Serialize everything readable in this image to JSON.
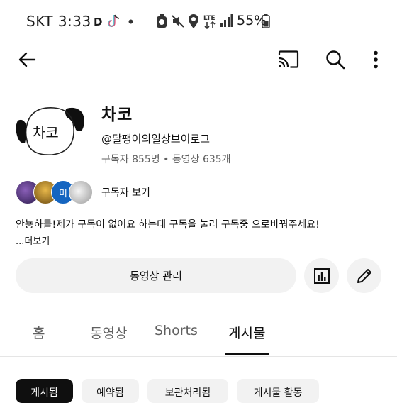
{
  "status_bar": {
    "carrier_time": "SKT 3:33",
    "d_label": "D",
    "battery_percent": "55%",
    "icons": [
      "tiktok-icon",
      "dot-icon",
      "alarm-icon",
      "mute-icon",
      "location-icon",
      "lte-icon",
      "signal-icon",
      "battery-icon"
    ]
  },
  "app_bar": {
    "icons": [
      "back-arrow-icon",
      "cast-icon",
      "search-icon",
      "more-vertical-icon"
    ]
  },
  "channel": {
    "avatar_text": "차코",
    "title": "차코",
    "handle": "@달팽이의일상브이로그",
    "stats": "구독자 855명 • 동영상 635개",
    "subscribers_link": "구독자 보기",
    "sub_avatar_label": "미",
    "description": "안뇽하들!제가 구독이 없어요 하는데 구독을 눌러 구독중 으로바꿔주세요!",
    "more_label": "...더보기"
  },
  "actions": {
    "manage_videos_label": "동영상 관리",
    "analytics_icon": "analytics-icon",
    "edit_icon": "edit-pencil-icon"
  },
  "tabs": [
    {
      "label": "홈",
      "active": false
    },
    {
      "label": "동영상",
      "active": false
    },
    {
      "label": "Shorts",
      "active": false
    },
    {
      "label": "게시물",
      "active": true
    }
  ],
  "chips": [
    {
      "label": "게시됨",
      "active": true
    },
    {
      "label": "예약됨",
      "active": false
    },
    {
      "label": "보관처리됨",
      "active": false
    },
    {
      "label": "게시물 활동",
      "active": false
    }
  ],
  "colors": {
    "text": "#0f0f0f",
    "secondary_text": "#606060",
    "button_bg": "#f2f2f2",
    "chip_active_bg": "#0f0f0f"
  }
}
